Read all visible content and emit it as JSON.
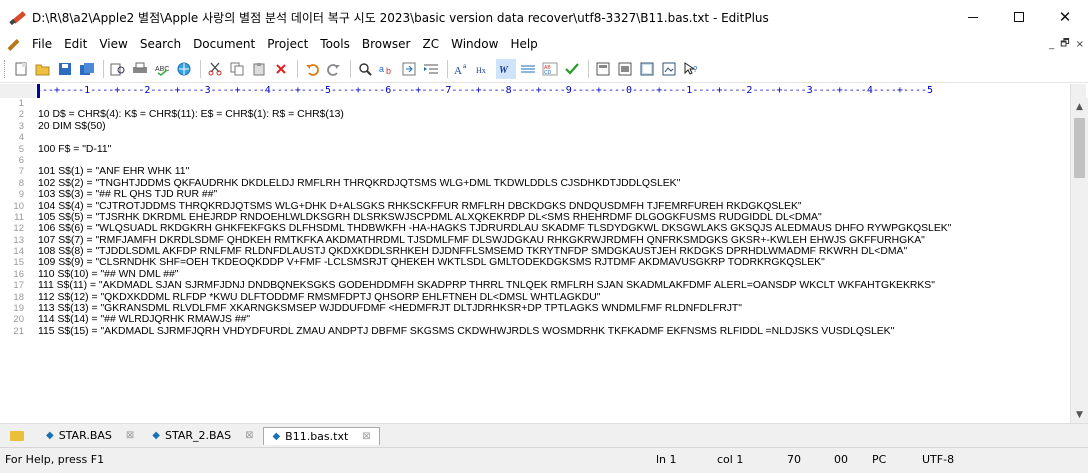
{
  "window": {
    "title": "D:\\R\\8\\a2\\Apple2 별점\\Apple 사랑의 별점 분석 데이터 복구 시도 2023\\basic version data recover\\utf8-3327\\B11.bas.txt - EditPlus",
    "minimize": "—",
    "close": "✕"
  },
  "menu": {
    "items": [
      "File",
      "Edit",
      "View",
      "Search",
      "Document",
      "Project",
      "Tools",
      "Browser",
      "ZC",
      "Window",
      "Help"
    ],
    "mdi_min": "_",
    "mdi_restore": "🗗",
    "mdi_close": "×"
  },
  "toolbar": {
    "icons": [
      "new-icon",
      "open-icon",
      "save-icon",
      "save-all-icon",
      "print-preview-icon",
      "print-icon",
      "spell-check-icon",
      "browser-icon",
      "cut-icon",
      "copy-icon",
      "paste-icon",
      "delete-icon",
      "undo-icon",
      "redo-icon",
      "find-icon",
      "replace-icon",
      "goto-icon",
      "indent-icon",
      "font-icon",
      "hex-icon",
      "word-wrap-icon",
      "column-icon",
      "line-number-icon",
      "check-icon",
      "view1-icon",
      "view2-icon",
      "view3-icon",
      "view4-icon",
      "help-icon"
    ]
  },
  "ruler": {
    "text": "---+----1----+----2----+----3----+----4----+----5----+----6----+----7----+----8----+----9----+----0----+----1----+----2----+----3----+----4----+----5"
  },
  "editor": {
    "lines": [
      {
        "n": "1",
        "code": ""
      },
      {
        "n": "2",
        "code": "10 D$ = CHR$(4): K$ = CHR$(11): E$ = CHR$(1): R$ = CHR$(13)"
      },
      {
        "n": "3",
        "code": "20 DIM S$(50)"
      },
      {
        "n": "4",
        "code": ""
      },
      {
        "n": "5",
        "code": "100 F$ = \"D-11\""
      },
      {
        "n": "6",
        "code": ""
      },
      {
        "n": "7",
        "code": "101 S$(1) = \"ANF EHR WHK 11\""
      },
      {
        "n": "8",
        "code": "102 S$(2) = \"TNGHTJDDMS QKFAUDRHK DKDLELDJ RMFLRH THRQKRDJQTSMS WLG+DML TKDWLDDLS CJSDHKDTJDDLQSLEK\""
      },
      {
        "n": "9",
        "code": "103 S$(3) = \"## RL QHS TJD RUR ##\""
      },
      {
        "n": "10",
        "code": "104 S$(4) = \"CJTROTJDDMS THRQKRDJQTSMS WLG+DHK D+ALSGKS RHKSCKFFUR RMFLRH DBCKDGKS DNDQUSDMFH TJFEMRFUREH RKDGKQSLEK\""
      },
      {
        "n": "11",
        "code": "105 S$(5) = \"TJSRHK DKRDML EHEJRDP RNDOEHLWLDKSGRH DLSRKSWJSCPDML ALXQKEKRDP DL<SMS RHEHRDMF DLGOGKFUSMS RUDGIDDL DL<DMA\""
      },
      {
        "n": "12",
        "code": "106 S$(6) = \"WLQSUADL RKDGKRH GHKFEKFGKS DLFHSDML THDBWKFH -HA-HAGKS TJDRURDLAU SKADMF TLSDYDGKWL DKSGWLAKS GKSQJS ALEDMAUS DHFO RYWPGKQSLEK\""
      },
      {
        "n": "13",
        "code": "107 S$(7) = \"RMFJAMFH DKRDLSDMF QHDKEH RMTKFKA AKDMATHRDML TJSDMLFMF DLSWJDGKAU RHKGKRWJRDMFH QNFRKSMDGKS GKSR+-KWLEH EHWJS GKFFURHGKA\""
      },
      {
        "n": "14",
        "code": "108 S$(8) = \"TJDDLSDML AKFDP RNLFMF RLDNFDLAUSTJ QKDXKDDLSRHKEH DJDNFFLSMSEMD TKRYTNFDP SMDGKAUSTJEH RKDGKS DPRHDLWMADMF RKWRH DL<DMA\""
      },
      {
        "n": "15",
        "code": "109 S$(9) = \"CLSRNDHK SHF=OEH TKDEOQKDDP V+FMF -LCLSMSRJT QHEKEH WKTLSDL GMLTODEKDGKSMS RJTDMF AKDMAVUSGKRP TODRKRGKQSLEK\""
      },
      {
        "n": "16",
        "code": "110 S$(10) = \"## WN DML ##\""
      },
      {
        "n": "17",
        "code": "111 S$(11) = \"AKDMADL SJAN SJRMFJDNJ DNDBQNEKSGKS GODEHDDMFH SKADPRP THRRL TNLQEK RMFLRH SJAN SKADMLAKFDMF ALERL=OANSDP WKCLT WKFAHTGKEKRKS\""
      },
      {
        "n": "18",
        "code": "112 S$(12) = \"QKDXKDDML RLFDP *KWU DLFTODDMF RMSMFDPTJ QHSORP EHLFTNEH DL<DMSL WHTLAGKDU\""
      },
      {
        "n": "19",
        "code": "113 S$(13) = \"GKRANSDML RLVDLFMF XKARNGKSMSEP WJDDUFDMF <HEDMFRJT DLTJDRHKSR+DP TPTLAGKS WNDMLFMF RLDNFDLFRJT\""
      },
      {
        "n": "20",
        "code": "114 S$(14) = \"## WLRDJQRHK RMAWJS ##\""
      },
      {
        "n": "21",
        "code": "115 S$(15) = \"AKDMADL SJRMFJQRH VHDYDFURDL ZMAU ANDPTJ DBFMF SKGSMS CKDWHWJRDLS WOSMDRHK TKFKADMF EKFNSMS RLFIDDL =NLDJSKS VUSDLQSLEK\""
      }
    ]
  },
  "tabs": [
    {
      "label": "STAR.BAS",
      "active": false
    },
    {
      "label": "STAR_2.BAS",
      "active": false
    },
    {
      "label": "B11.bas.txt",
      "active": true
    }
  ],
  "tab_close": "⊠",
  "status": {
    "help": "For Help, press F1",
    "ln": "ln 1",
    "col": "col 1",
    "n70": "70",
    "n00": "00",
    "pc": "PC",
    "enc": "UTF-8"
  }
}
